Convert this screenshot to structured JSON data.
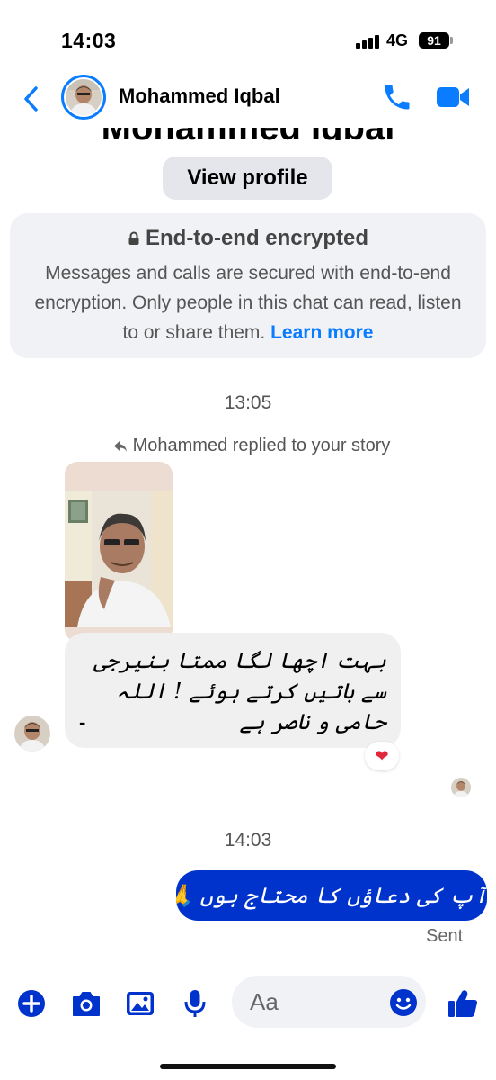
{
  "status_bar": {
    "time": "14:03",
    "network": "4G",
    "battery": "91"
  },
  "header": {
    "contact_name": "Mohammed Iqbal"
  },
  "profile": {
    "big_name": "Mohammed Iqbal",
    "view_profile_label": "View profile"
  },
  "encryption": {
    "title": "End-to-end encrypted",
    "body": "Messages and calls are secured with end-to-end encryption. Only people in this chat can read, listen to or share them.",
    "link": "Learn more"
  },
  "thread": {
    "timestamp_1": "13:05",
    "story_reply_note": "Mohammed replied to your story",
    "incoming_message": "بہت اچھا لگا ممتا بنیرجی سے باتیں کرتے ہوئے ! اللہ حامی و ناصر ہے",
    "incoming_message_tail": "-",
    "reaction": "❤",
    "timestamp_2": "14:03",
    "outgoing_message": "آپ کی دعاؤں کا محتاج ہوں 🙏",
    "sent_status": "Sent"
  },
  "composer": {
    "placeholder": "Aa"
  },
  "colors": {
    "accent": "#0a7cff",
    "outgoing_bubble": "#0033cc",
    "incoming_bubble": "#f0f0f0",
    "card": "#f0f2f5"
  }
}
